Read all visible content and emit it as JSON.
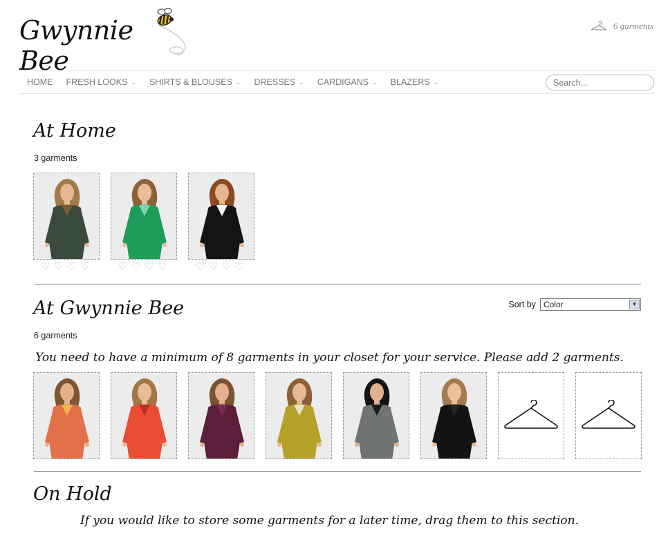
{
  "header": {
    "logo_text": "Gwynnie Bee",
    "cart_label": "6 garments"
  },
  "nav": {
    "items": [
      {
        "label": "HOME",
        "has_menu": false
      },
      {
        "label": "FRESH LOOKS",
        "has_menu": true
      },
      {
        "label": "SHIRTS & BLOUSES",
        "has_menu": true
      },
      {
        "label": "DRESSES",
        "has_menu": true
      },
      {
        "label": "CARDIGANS",
        "has_menu": true
      },
      {
        "label": "BLAZERS",
        "has_menu": true
      }
    ],
    "search_placeholder": "Search..."
  },
  "at_home": {
    "title": "At Home",
    "count": "3 garments",
    "garments": [
      {
        "color": "#3a4a3c",
        "accent": "#7a5a36",
        "hair": "#a27a4a",
        "skin": "#e6b894"
      },
      {
        "color": "#1f9b5a",
        "accent": "#7cd6b4",
        "hair": "#8d6238",
        "skin": "#e8bd9a"
      },
      {
        "color": "#141414",
        "accent": "#ffffff",
        "hair": "#8a4a22",
        "skin": "#e6b592"
      }
    ]
  },
  "at_gwynnie": {
    "title": "At Gwynnie Bee",
    "count": "6 garments",
    "sort_label": "Sort by",
    "sort_value": "Color",
    "notice": "You need to have a minimum of 8 garments in your closet for your service. Please add 2 garments.",
    "garments": [
      {
        "color": "#e2714a",
        "accent": "#f3b84a",
        "hair": "#7e5634",
        "skin": "#e3b28c"
      },
      {
        "color": "#ea4c31",
        "accent": "#b8321f",
        "hair": "#a37648",
        "skin": "#e8bc97"
      },
      {
        "color": "#5c1f3b",
        "accent": "#7a2c4f",
        "hair": "#7d5230",
        "skin": "#e2b08e"
      },
      {
        "color": "#b5a028",
        "accent": "#e9e2c8",
        "hair": "#8c6138",
        "skin": "#e6b893"
      },
      {
        "color": "#6f7470",
        "accent": "#1b1b1b",
        "hair": "#141414",
        "skin": "#e0b08c"
      },
      {
        "color": "#131313",
        "accent": "#222222",
        "hair": "#a47b4e",
        "skin": "#e8c09c"
      }
    ],
    "empty_slots": 2
  },
  "on_hold": {
    "title": "On Hold",
    "notice": "If you would like to store some garments for a later time, drag them to this section."
  }
}
